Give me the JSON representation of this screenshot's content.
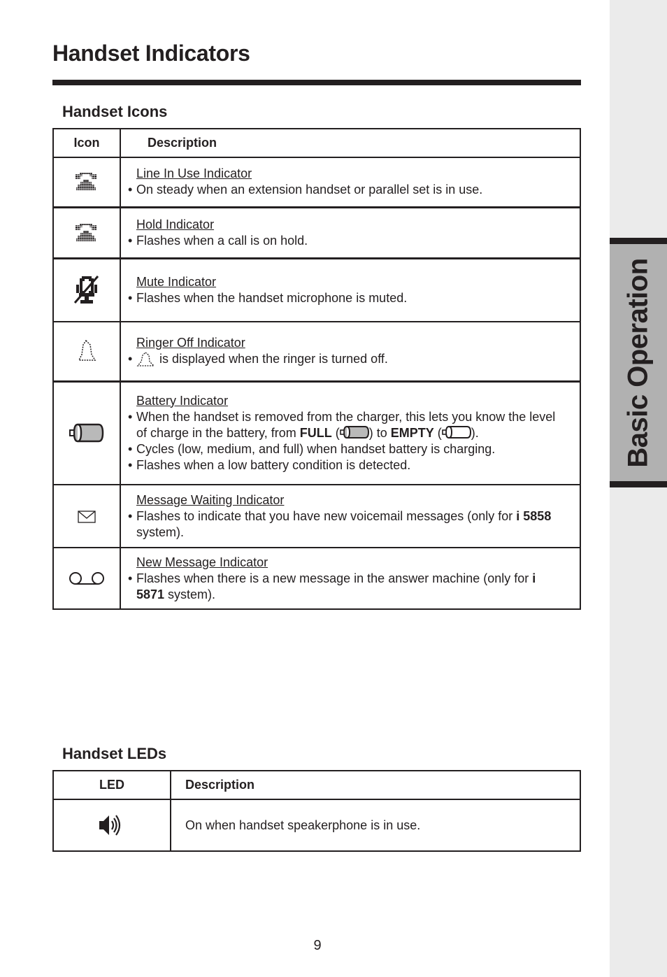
{
  "page": {
    "title": "Handset Indicators",
    "page_number": "9",
    "side_tab": "Basic Operation"
  },
  "icons_section": {
    "title": "Handset Icons",
    "headers": {
      "icon": "Icon",
      "description": "Description"
    },
    "rows": [
      {
        "icon": "line-in-use-icon",
        "name": "Line In Use Indicator",
        "bullets": [
          "On steady when an extension handset or parallel set is in use."
        ]
      },
      {
        "icon": "hold-icon",
        "name": "Hold Indicator",
        "bullets": [
          "Flashes when a call is on hold."
        ]
      },
      {
        "icon": "mute-icon",
        "name": "Mute Indicator",
        "bullets": [
          "Flashes when the handset microphone is muted."
        ]
      },
      {
        "icon": "ringer-off-icon",
        "name": "Ringer Off Indicator",
        "bullets": [
          "is displayed when the ringer is turned off."
        ]
      },
      {
        "icon": "battery-icon",
        "name": "Battery Indicator",
        "bullet1_a": "When the handset is removed from the charger, this lets you know the level of charge in the battery, from ",
        "full_label": "FULL",
        "bullet1_b": " (",
        "bullet1_c": ") to ",
        "empty_label": "EMPTY",
        "bullet1_d": " (",
        "bullet1_e": ").",
        "bullets": [
          "Cycles (low, medium, and full) when handset battery is charging.",
          "Flashes when a low battery condition is detected."
        ]
      },
      {
        "icon": "message-waiting-icon",
        "name": "Message Waiting Indicator",
        "text_a": "Flashes to indicate that you have new voicemail messages (only for ",
        "model": "i 5858",
        "text_b": " system)."
      },
      {
        "icon": "new-message-icon",
        "name": "New Message Indicator",
        "text_a": "Flashes when there is a new message in the answer machine (only for ",
        "model": "i 5871",
        "text_b": " system)."
      }
    ]
  },
  "leds_section": {
    "title": "Handset LEDs",
    "headers": {
      "led": "LED",
      "description": "Description"
    },
    "rows": [
      {
        "icon": "speakerphone-icon",
        "description": "On when handset speakerphone is in use."
      }
    ]
  },
  "bullet_char": "•"
}
